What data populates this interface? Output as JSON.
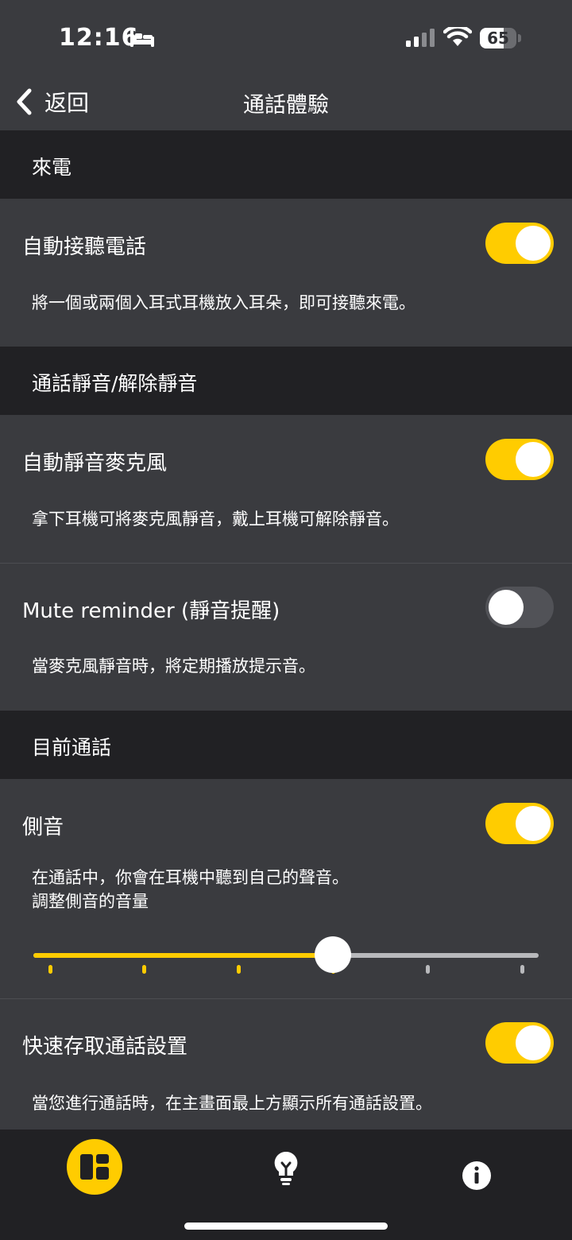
{
  "status_bar": {
    "time": "12:16",
    "battery": "65",
    "battery_level": 0.65
  },
  "nav": {
    "back_label": "返回",
    "title": "通話體驗"
  },
  "sections": {
    "incoming": {
      "header": "來電",
      "auto_answer": {
        "title": "自動接聽電話",
        "on": true,
        "description": "將一個或兩個入耳式耳機放入耳朵，即可接聽來電。"
      }
    },
    "mute": {
      "header": "通話靜音/解除靜音",
      "auto_mute": {
        "title": "自動靜音麥克風",
        "on": true,
        "description": "拿下耳機可將麥克風靜音，戴上耳機可解除靜音。"
      },
      "mute_reminder": {
        "title": "Mute reminder (靜音提醒)",
        "on": false,
        "description": "當麥克風靜音時，將定期播放提示音。"
      }
    },
    "current_call": {
      "header": "目前通話",
      "sidetone": {
        "title": "側音",
        "on": true,
        "description": "在通話中，你會在耳機中聽到自己的聲音。",
        "adjust_label": "調整側音的音量",
        "level_steps": 6,
        "level_value": 4
      },
      "quick_access": {
        "title": "快速存取通話設置",
        "on": true,
        "description": "當您進行通話時，在主畫面最上方顯示所有通話設置。"
      }
    }
  },
  "colors": {
    "accent": "#ffcc00",
    "background": "#3a3b3f",
    "section_header": "#212124",
    "toggle_off": "#515257"
  },
  "tabs": [
    {
      "name": "dashboard-icon",
      "active": true
    },
    {
      "name": "tips-lightbulb-icon",
      "active": false
    },
    {
      "name": "info-icon",
      "active": false
    }
  ]
}
